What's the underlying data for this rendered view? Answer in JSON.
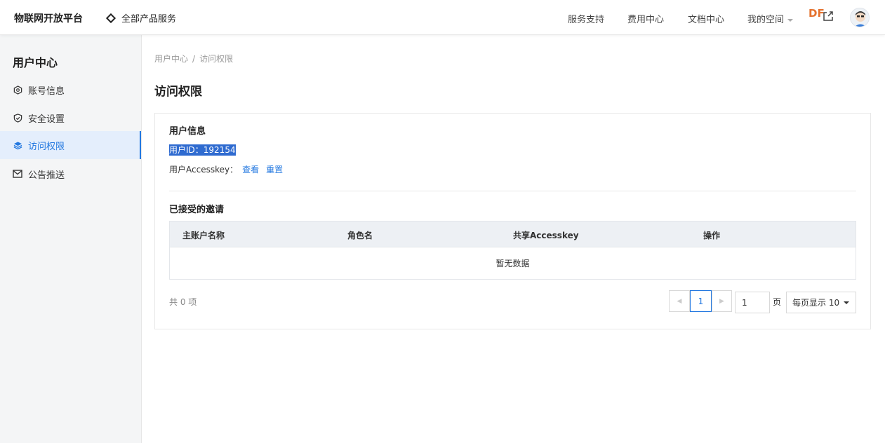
{
  "header": {
    "brand": "物联网开放平台",
    "all_products": "全部产品服务",
    "nav": [
      "服务支持",
      "费用中心",
      "文档中心",
      "我的空间"
    ],
    "df_logo": "DF"
  },
  "sidebar": {
    "title": "用户中心",
    "items": [
      {
        "label": "账号信息",
        "icon": "hexagon-icon"
      },
      {
        "label": "安全设置",
        "icon": "shield-icon"
      },
      {
        "label": "访问权限",
        "icon": "layers-icon",
        "active": true
      },
      {
        "label": "公告推送",
        "icon": "mail-icon"
      }
    ]
  },
  "breadcrumb": {
    "parent": "用户中心",
    "sep": "/",
    "current": "访问权限"
  },
  "page_title": "访问权限",
  "user_info": {
    "title": "用户信息",
    "user_id": "用户ID：192154",
    "accesskey_label": "用户Accesskey：",
    "view_link": "查看",
    "reset_link": "重置"
  },
  "invitations": {
    "title": "已接受的邀请",
    "columns": [
      "主账户名称",
      "角色名",
      "共享Accesskey",
      "操作"
    ],
    "empty_text": "暂无数据"
  },
  "pagination": {
    "total": "共 0 项",
    "current_page": "1",
    "goto_value": "1",
    "page_unit": "页",
    "page_size": "每页显示 10"
  },
  "colors": {
    "accent": "#2378e0",
    "selection": "#2f6bd0",
    "df_logo": "#e5722f"
  }
}
